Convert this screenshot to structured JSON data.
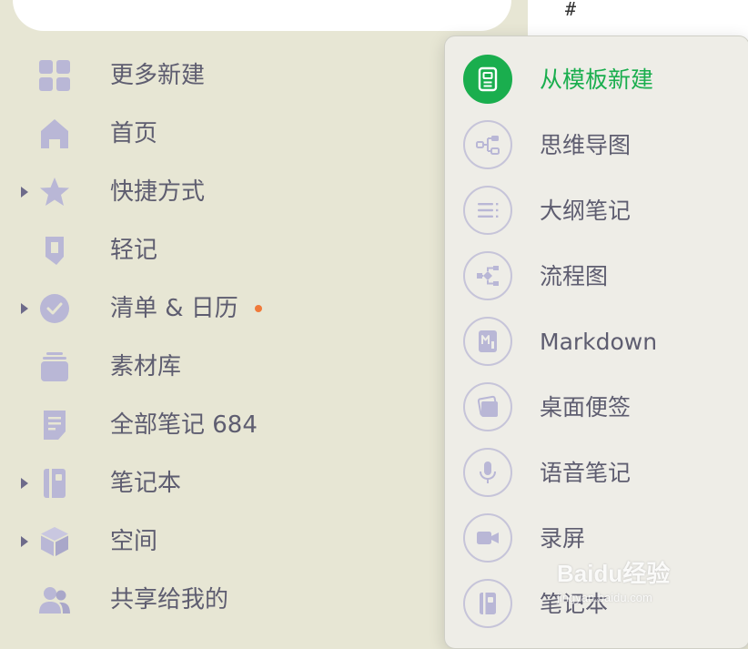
{
  "header": {
    "hash_symbol": "#"
  },
  "sidebar": {
    "items": [
      {
        "label": "更多新建",
        "icon": "grid-icon",
        "has_caret": false
      },
      {
        "label": "首页",
        "icon": "home-icon",
        "has_caret": false
      },
      {
        "label": "快捷方式",
        "icon": "star-icon",
        "has_caret": true
      },
      {
        "label": "轻记",
        "icon": "quick-note-icon",
        "has_caret": false
      },
      {
        "label": "清单 & 日历",
        "icon": "check-circle-icon",
        "has_caret": true,
        "badge_color": "#f07a3a"
      },
      {
        "label": "素材库",
        "icon": "stack-icon",
        "has_caret": false
      },
      {
        "label": "全部笔记 684",
        "icon": "note-doc-icon",
        "has_caret": false
      },
      {
        "label": "笔记本",
        "icon": "notebook-icon",
        "has_caret": true
      },
      {
        "label": "空间",
        "icon": "cube-icon",
        "has_caret": true
      },
      {
        "label": "共享给我的",
        "icon": "people-icon",
        "has_caret": false
      }
    ]
  },
  "menu": {
    "items": [
      {
        "label": "从模板新建",
        "icon": "template-icon",
        "active": true
      },
      {
        "label": "思维导图",
        "icon": "mindmap-icon"
      },
      {
        "label": "大纲笔记",
        "icon": "outline-icon"
      },
      {
        "label": "流程图",
        "icon": "flowchart-icon"
      },
      {
        "label": "Markdown",
        "icon": "markdown-icon"
      },
      {
        "label": "桌面便签",
        "icon": "sticky-note-icon"
      },
      {
        "label": "语音笔记",
        "icon": "microphone-icon"
      },
      {
        "label": "录屏",
        "icon": "video-camera-icon"
      },
      {
        "label": "笔记本",
        "icon": "notebook-icon"
      }
    ]
  },
  "colors": {
    "background": "#e7e6d4",
    "menu_background": "#eeede7",
    "accent_green": "#1aae4e",
    "icon_purple": "#b9b7d6",
    "text": "#5e5d70",
    "badge": "#f07a3a"
  },
  "watermark": {
    "main": "Baidu经验",
    "sub": "jingyan.baidu.com"
  }
}
